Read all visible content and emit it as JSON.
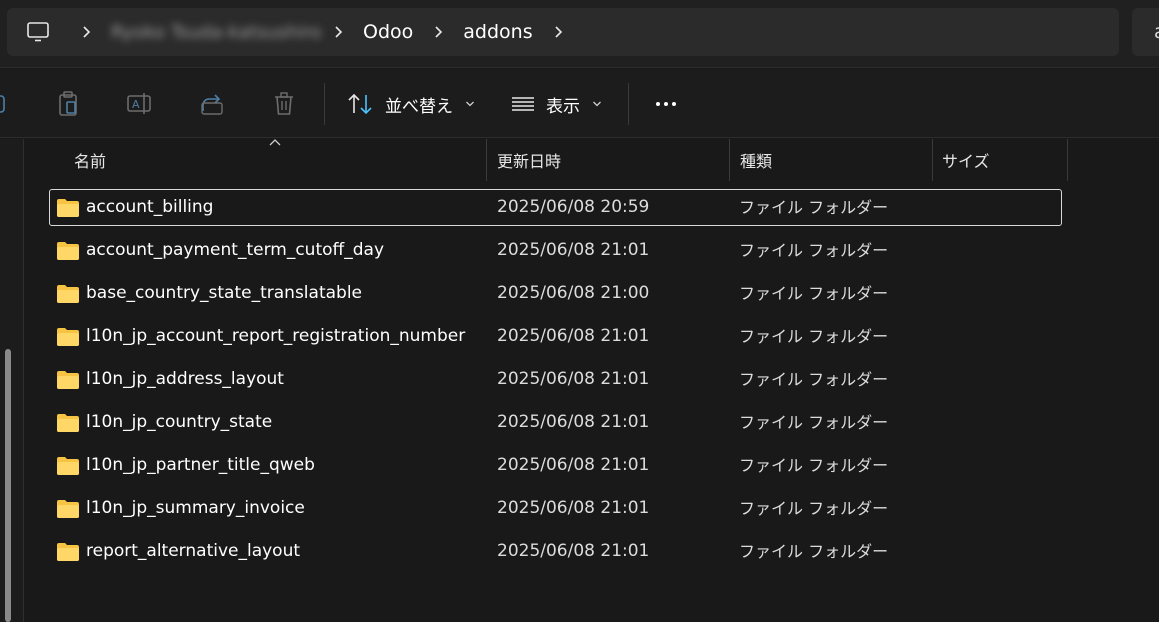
{
  "breadcrumb": {
    "items": [
      {
        "label": "Ryoko Tsuda-katsushiro",
        "blurred": true
      },
      {
        "label": "Odoo",
        "blurred": false
      },
      {
        "label": "addons",
        "blurred": false
      }
    ]
  },
  "search": {
    "visible_text": "a"
  },
  "toolbar": {
    "sort_label": "並べ替え",
    "view_label": "表示"
  },
  "columns": {
    "name": "名前",
    "modified": "更新日時",
    "type": "種類",
    "size": "サイズ"
  },
  "rows": [
    {
      "name": "account_billing",
      "modified": "2025/06/08 20:59",
      "type": "ファイル フォルダー",
      "selected": true
    },
    {
      "name": "account_payment_term_cutoff_day",
      "modified": "2025/06/08 21:01",
      "type": "ファイル フォルダー"
    },
    {
      "name": "base_country_state_translatable",
      "modified": "2025/06/08 21:00",
      "type": "ファイル フォルダー"
    },
    {
      "name": "l10n_jp_account_report_registration_number",
      "modified": "2025/06/08 21:01",
      "type": "ファイル フォルダー"
    },
    {
      "name": "l10n_jp_address_layout",
      "modified": "2025/06/08 21:01",
      "type": "ファイル フォルダー"
    },
    {
      "name": "l10n_jp_country_state",
      "modified": "2025/06/08 21:01",
      "type": "ファイル フォルダー"
    },
    {
      "name": "l10n_jp_partner_title_qweb",
      "modified": "2025/06/08 21:01",
      "type": "ファイル フォルダー"
    },
    {
      "name": "l10n_jp_summary_invoice",
      "modified": "2025/06/08 21:01",
      "type": "ファイル フォルダー"
    },
    {
      "name": "report_alternative_layout",
      "modified": "2025/06/08 21:01",
      "type": "ファイル フォルダー"
    }
  ],
  "colors": {
    "accent": "#4cc2ff",
    "folder": "#f6c343",
    "background": "#191919"
  }
}
